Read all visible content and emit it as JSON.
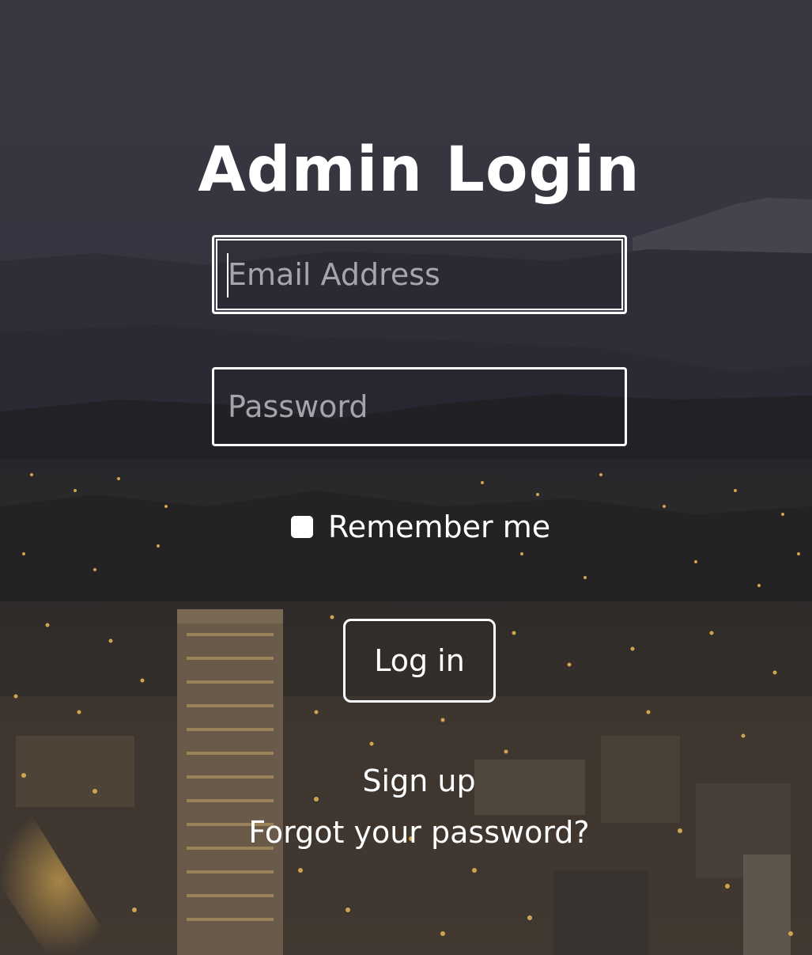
{
  "page": {
    "title": "Admin Login"
  },
  "form": {
    "email": {
      "value": "",
      "placeholder": "Email Address"
    },
    "password": {
      "value": "",
      "placeholder": "Password"
    },
    "remember": {
      "label": "Remember me",
      "checked": false
    },
    "submit_label": "Log in"
  },
  "links": {
    "signup": "Sign up",
    "forgot": "Forgot your password?"
  },
  "colors": {
    "text": "#ffffff",
    "sky": "#3e3d48",
    "city_lights": "#f2c14e"
  },
  "background": {
    "description_icon": "city-night-skyline-image"
  }
}
